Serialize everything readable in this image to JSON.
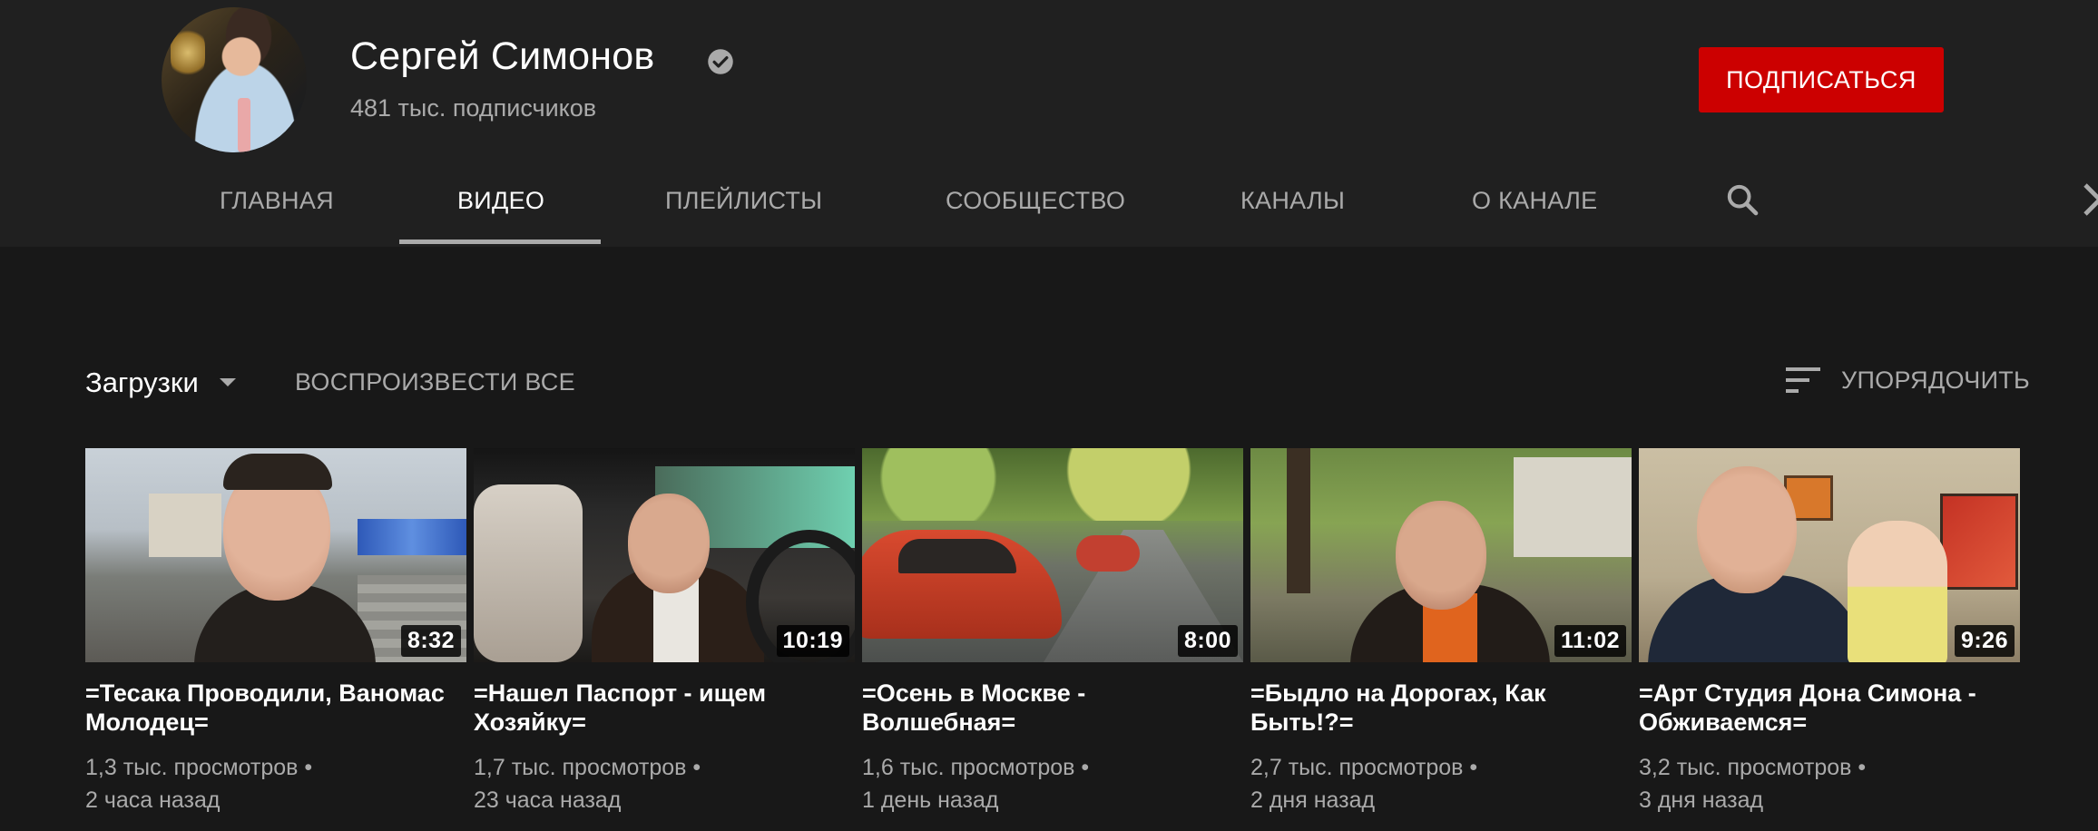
{
  "channel": {
    "name": "Сергей Симонов",
    "subscribers": "481 тыс. подписчиков",
    "verified_icon": "verified-check-icon",
    "subscribe_label": "ПОДПИСАТЬСЯ",
    "subscribe_color": "#cc0000"
  },
  "tabs": [
    {
      "label": "ГЛАВНАЯ"
    },
    {
      "label": "ВИДЕО",
      "active": true
    },
    {
      "label": "ПЛЕЙЛИСТЫ"
    },
    {
      "label": "СООБЩЕСТВО"
    },
    {
      "label": "КАНАЛЫ"
    },
    {
      "label": "О КАНАЛЕ"
    }
  ],
  "toolbar": {
    "uploads_label": "Загрузки",
    "play_all_label": "ВОСПРОИЗВЕСТИ ВСЕ",
    "sort_label": "УПОРЯДОЧИТЬ"
  },
  "videos": [
    {
      "title": "=Тесака Проводили, Ваномас Молодец=",
      "duration": "8:32",
      "views": "1,3 тыс. просмотров",
      "age": "2 часа назад"
    },
    {
      "title": "=Нашел Паспорт - ищем Хозяйку=",
      "duration": "10:19",
      "views": "1,7 тыс. просмотров",
      "age": "23 часа назад"
    },
    {
      "title": "=Осень в Москве - Волшебная=",
      "duration": "8:00",
      "views": "1,6 тыс. просмотров",
      "age": "1 день назад"
    },
    {
      "title": "=Быдло на Дорогах, Как Быть!?=",
      "duration": "11:02",
      "views": "2,7 тыс. просмотров",
      "age": "2 дня назад"
    },
    {
      "title": "=Арт Студия Дона Симона - Обживаемся=",
      "duration": "9:26",
      "views": "3,2 тыс. просмотров",
      "age": "3 дня назад"
    }
  ],
  "separator": "•"
}
